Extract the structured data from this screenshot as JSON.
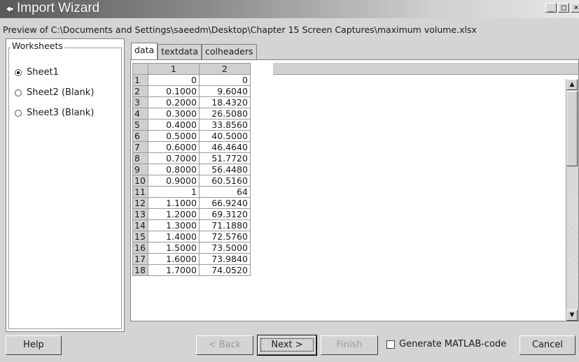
{
  "window": {
    "title": "Import Wizard",
    "preview_text": "Preview of C:\\Documents and Settings\\saeedm\\Desktop\\Chapter 15 Screen Captures\\maximum volume.xlsx",
    "controls": [
      "_",
      "□",
      "×"
    ]
  },
  "worksheets": {
    "legend": "Worksheets",
    "selected": "Sheet1",
    "items": [
      "Sheet1",
      "Sheet2 (Blank)",
      "Sheet3 (Blank)"
    ]
  },
  "tabs": [
    {
      "label": "data",
      "active": true
    },
    {
      "label": "textdata",
      "active": false
    },
    {
      "label": "colheaders",
      "active": false
    }
  ],
  "grid": {
    "column_headers": [
      "1",
      "2"
    ],
    "rows": [
      {
        "n": "1",
        "c1": "0",
        "c2": "0"
      },
      {
        "n": "2",
        "c1": "0.1000",
        "c2": "9.6040"
      },
      {
        "n": "3",
        "c1": "0.2000",
        "c2": "18.4320"
      },
      {
        "n": "4",
        "c1": "0.3000",
        "c2": "26.5080"
      },
      {
        "n": "5",
        "c1": "0.4000",
        "c2": "33.8560"
      },
      {
        "n": "6",
        "c1": "0.5000",
        "c2": "40.5000"
      },
      {
        "n": "7",
        "c1": "0.6000",
        "c2": "46.4640"
      },
      {
        "n": "8",
        "c1": "0.7000",
        "c2": "51.7720"
      },
      {
        "n": "9",
        "c1": "0.8000",
        "c2": "56.4480"
      },
      {
        "n": "10",
        "c1": "0.9000",
        "c2": "60.5160"
      },
      {
        "n": "11",
        "c1": "1",
        "c2": "64"
      },
      {
        "n": "12",
        "c1": "1.1000",
        "c2": "66.9240"
      },
      {
        "n": "13",
        "c1": "1.2000",
        "c2": "69.3120"
      },
      {
        "n": "14",
        "c1": "1.3000",
        "c2": "71.1880"
      },
      {
        "n": "15",
        "c1": "1.4000",
        "c2": "72.5760"
      },
      {
        "n": "16",
        "c1": "1.5000",
        "c2": "73.5000"
      },
      {
        "n": "17",
        "c1": "1.6000",
        "c2": "73.9840"
      },
      {
        "n": "18",
        "c1": "1.7000",
        "c2": "74.0520"
      }
    ]
  },
  "buttons": {
    "help": "Help",
    "back": "< Back",
    "next": "Next >",
    "finish": "Finish",
    "generate_code": "Generate MATLAB-code",
    "cancel": "Cancel"
  },
  "icons": {
    "app": "import-wizard-icon",
    "scroll_up": "scroll-up-arrow-icon",
    "scroll_down": "scroll-down-arrow-icon"
  }
}
